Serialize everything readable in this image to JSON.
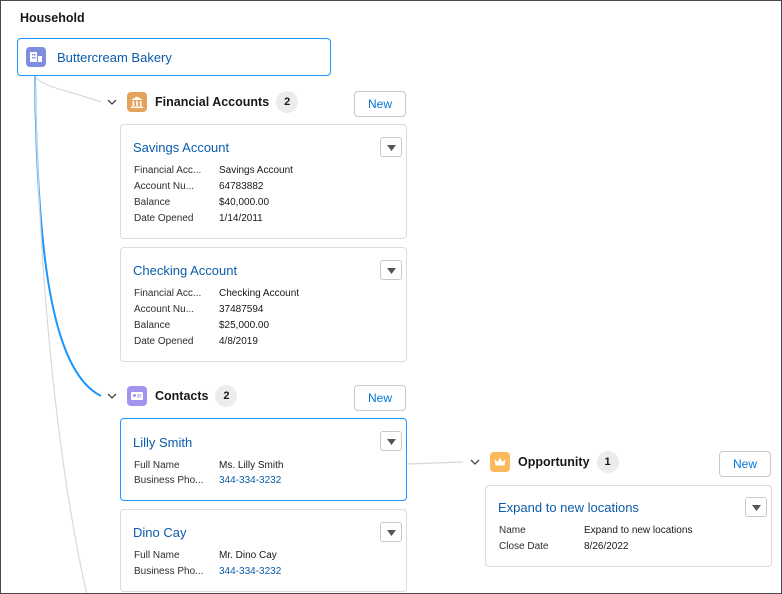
{
  "page": {
    "title": "Household"
  },
  "root": {
    "name": "Buttercream Bakery",
    "icon": "household-icon",
    "icon_color": "#7f8de1"
  },
  "groups": {
    "financial_accounts": {
      "label": "Financial Accounts",
      "count": "2",
      "new_label": "New",
      "icon": "bank-icon",
      "icon_color": "#e3a35a",
      "cards": [
        {
          "title": "Savings Account",
          "fields": [
            {
              "label": "Financial Acc...",
              "value": "Savings Account"
            },
            {
              "label": "Account Nu...",
              "value": "64783882"
            },
            {
              "label": "Balance",
              "value": "$40,000.00"
            },
            {
              "label": "Date Opened",
              "value": "1/14/2011"
            }
          ]
        },
        {
          "title": "Checking Account",
          "fields": [
            {
              "label": "Financial Acc...",
              "value": "Checking Account"
            },
            {
              "label": "Account Nu...",
              "value": "37487594"
            },
            {
              "label": "Balance",
              "value": "$25,000.00"
            },
            {
              "label": "Date Opened",
              "value": "4/8/2019"
            }
          ]
        }
      ]
    },
    "contacts": {
      "label": "Contacts",
      "count": "2",
      "new_label": "New",
      "icon": "contact-card-icon",
      "icon_color": "#a094ed",
      "cards": [
        {
          "title": "Lilly Smith",
          "fields": [
            {
              "label": "Full Name",
              "value": "Ms. Lilly Smith"
            },
            {
              "label": "Business Pho...",
              "value": "344-334-3232"
            }
          ]
        },
        {
          "title": "Dino Cay",
          "fields": [
            {
              "label": "Full Name",
              "value": "Mr. Dino Cay"
            },
            {
              "label": "Business Pho...",
              "value": "344-334-3232"
            }
          ]
        }
      ]
    },
    "opportunity": {
      "label": "Opportunity",
      "count": "1",
      "new_label": "New",
      "icon": "crown-icon",
      "icon_color": "#fcb95b",
      "cards": [
        {
          "title": "Expand to new locations",
          "fields": [
            {
              "label": "Name",
              "value": "Expand to new locations"
            },
            {
              "label": "Close Date",
              "value": "8/26/2022"
            }
          ]
        }
      ]
    }
  },
  "colors": {
    "link": "#0b5cab",
    "selected_border": "#1b96ff",
    "active_connector": "#1b96ff",
    "connector": "#d8d8d8"
  }
}
